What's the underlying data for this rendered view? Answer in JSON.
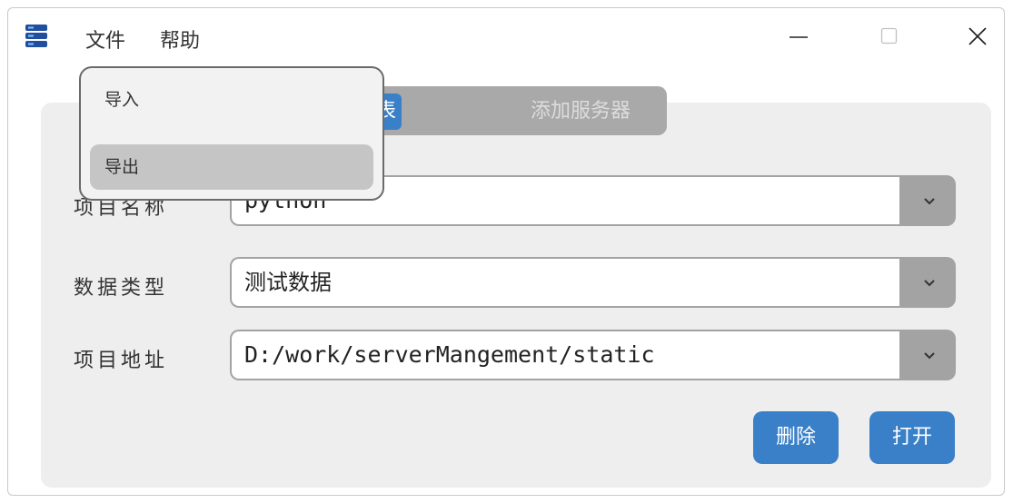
{
  "titlebar": {
    "app_icon": "server-stack-icon",
    "menus": [
      {
        "label": "文件"
      },
      {
        "label": "帮助"
      }
    ],
    "controls": {
      "minimize": "minimize-icon",
      "maximize": "maximize-icon",
      "close": "close-icon"
    }
  },
  "tabs": [
    {
      "label": "服务器列表",
      "active": true
    },
    {
      "label": "添加服务器",
      "active": false
    }
  ],
  "form": {
    "project_name": {
      "label": "项目名称",
      "value": "python"
    },
    "data_type": {
      "label": "数据类型",
      "value": "测试数据"
    },
    "project_path": {
      "label": "项目地址",
      "value": "D:/work/serverMangement/static"
    }
  },
  "buttons": {
    "delete": "删除",
    "open": "打开"
  },
  "file_menu": {
    "items": [
      {
        "label": "导入",
        "highlighted": false
      },
      {
        "label": "导出",
        "highlighted": true
      }
    ]
  },
  "colors": {
    "accent": "#3a80c8",
    "panel": "#eeeeee",
    "combo_button": "#a3a3a3",
    "tab_group": "#a9a9a9"
  }
}
